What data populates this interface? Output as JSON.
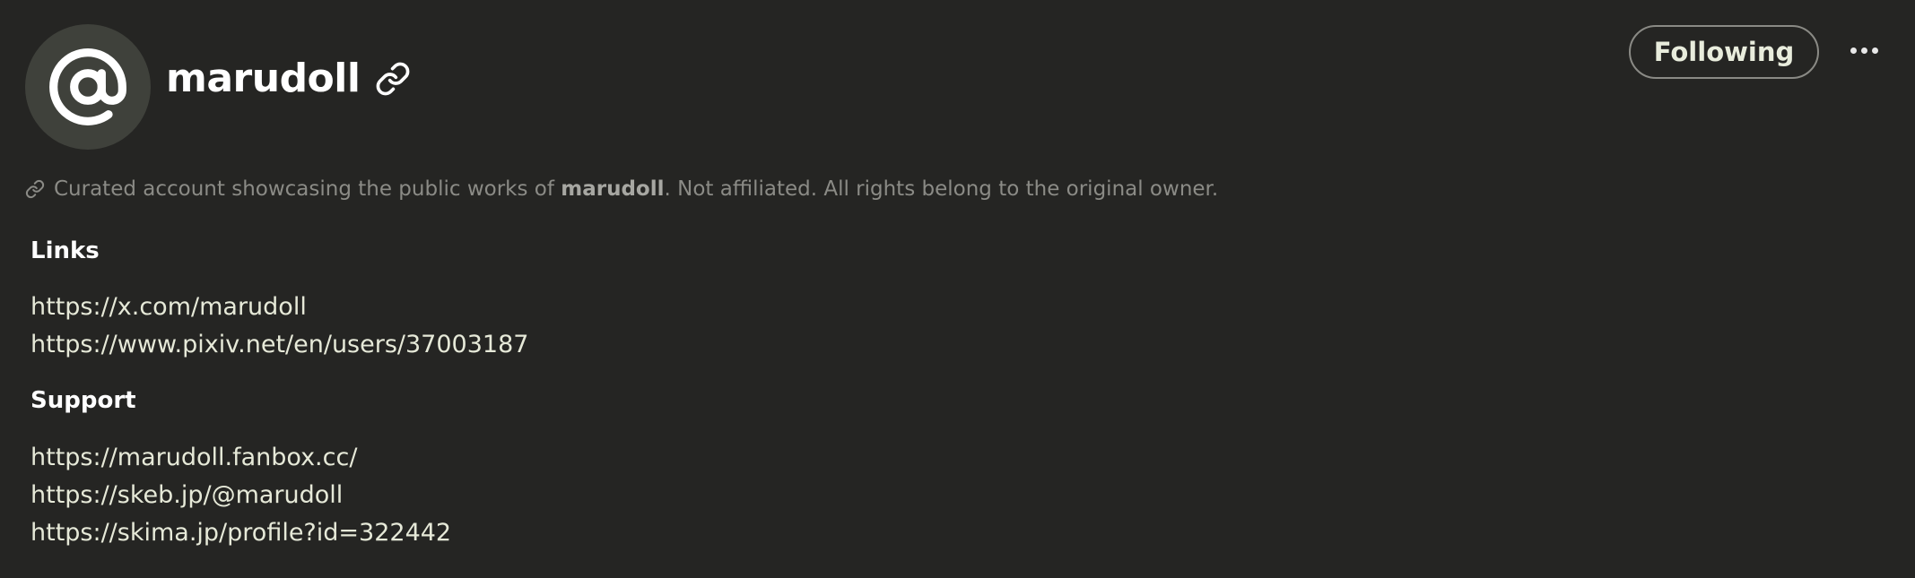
{
  "profile": {
    "avatar_icon": "at-sign-icon",
    "username": "marudoll",
    "link_icon": "link-icon"
  },
  "actions": {
    "follow_label": "Following",
    "more_icon": "more-horizontal-icon"
  },
  "disclaimer": {
    "icon": "link-icon",
    "prefix": "Curated account showcasing the public works of ",
    "name": "marudoll",
    "suffix": ". Not affiliated. All rights belong to the original owner."
  },
  "sections": {
    "links": {
      "title": "Links",
      "items": [
        "https://x.com/marudoll",
        "https://www.pixiv.net/en/users/37003187"
      ]
    },
    "support": {
      "title": "Support",
      "items": [
        "https://marudoll.fanbox.cc/",
        "https://skeb.jp/@marudoll",
        "https://skima.jp/profile?id=322442"
      ]
    }
  },
  "colors": {
    "background": "#252523",
    "avatar_bg": "#3f413b",
    "link_text": "#e6e9d8",
    "muted_text": "#8b8b86"
  }
}
